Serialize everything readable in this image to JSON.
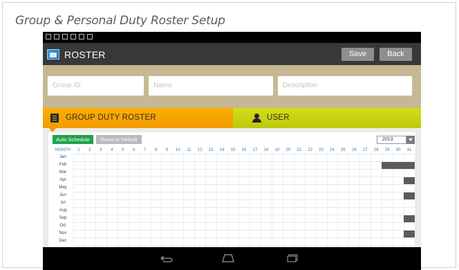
{
  "caption": "Group & Personal Duty Roster Setup",
  "app": {
    "title": "ROSTER",
    "save_label": "Save",
    "back_label": "Back"
  },
  "form": {
    "group_id_placeholder": "Group ID",
    "name_placeholder": "Name",
    "description_placeholder": "Description"
  },
  "tabs": {
    "group": "GROUP DUTY ROSTER",
    "user": "USER"
  },
  "toolbar": {
    "auto_schedule": "Auto Schedule",
    "reset_default": "Reset to Default",
    "year": "2013"
  },
  "grid": {
    "month_header": "MONTH",
    "days": [
      "1",
      "2",
      "3",
      "4",
      "5",
      "6",
      "7",
      "8",
      "9",
      "10",
      "11",
      "12",
      "13",
      "14",
      "15",
      "16",
      "17",
      "18",
      "19",
      "20",
      "21",
      "22",
      "23",
      "24",
      "25",
      "26",
      "27",
      "28",
      "29",
      "30",
      "31"
    ],
    "months": [
      "Jan",
      "Feb",
      "Mar",
      "Apr",
      "May",
      "Jun",
      "Jul",
      "Aug",
      "Sep",
      "Oct",
      "Nov",
      "Dec"
    ],
    "unavailable": [
      {
        "month": "Feb",
        "days": [
          29,
          30,
          31
        ]
      },
      {
        "month": "Apr",
        "days": [
          31
        ]
      },
      {
        "month": "Jun",
        "days": [
          31
        ]
      },
      {
        "month": "Sep",
        "days": [
          31
        ]
      },
      {
        "month": "Nov",
        "days": [
          31
        ]
      }
    ]
  },
  "colors": {
    "appbar": "#383838",
    "group_tab": "#f6a800",
    "user_tab": "#c9d10f",
    "auto_schedule": "#1ea34a",
    "blocked_day": "#5b5b5b",
    "header_text": "#2a7dc0"
  },
  "icons": {
    "app": "roster-logo-icon",
    "group_tab": "list-icon",
    "user_tab": "user-icon",
    "nav": [
      "back-icon",
      "home-icon",
      "recent-apps-icon"
    ]
  }
}
